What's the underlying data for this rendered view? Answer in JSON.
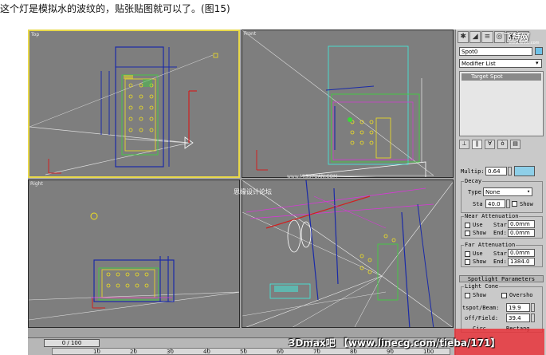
{
  "caption": "这个灯是模拟水的波纹的，贴张贴图就可以了。(图15)",
  "viewports": {
    "top": "Top",
    "front": "Front",
    "right": "Right"
  },
  "logo": {
    "text": "飞特网",
    "sub": "www.fevte.com"
  },
  "command_panel": {
    "object_name": "Spot0",
    "modifier_list": "Modifier List",
    "stack_item": "Target Spot",
    "multiplier_label": "Multip:",
    "multiplier_value": "0.64",
    "color_swatch": "#8ecfe8",
    "decay": {
      "title": "Decay",
      "type_label": "Type",
      "type_value": "None",
      "start_label": "Sta",
      "start_value": "40.0",
      "show_label": "Show"
    },
    "near": {
      "title": "Near Attenuation",
      "use": "Use",
      "show": "Show",
      "start_label": "Star",
      "start_value": "0.0mm",
      "end_label": "End:",
      "end_value": "0.0mm"
    },
    "far": {
      "title": "Far Attenuation",
      "use": "Use",
      "show": "Show",
      "start_label": "Star",
      "start_value": "0.0mm",
      "end_label": "End:",
      "end_value": "1384.0"
    },
    "spot_rollout": "Spotlight Parameters",
    "light_cone": {
      "title": "Light Cone",
      "show": "Show",
      "overshoot": "Oversho",
      "hotspot_label": "tspot/Beam:",
      "hotspot_value": "19.9",
      "falloff_label": "off/Field:",
      "falloff_value": "39.4",
      "circle": "Circ",
      "rect": "Rectang"
    }
  },
  "timeline": {
    "frame": "0 / 100",
    "ticks": [
      "10",
      "20",
      "30",
      "40",
      "50",
      "60",
      "70",
      "80",
      "90",
      "100"
    ]
  },
  "watermarks": {
    "bottom": "3Dmax吧 【www.linecg.com/tieba/171】",
    "middle": "思缘设计论坛",
    "middle2": "www.MISSYUAN.COM"
  },
  "colors": {
    "viewport_bg": "#7e7e7e",
    "active_border": "#e8d84a",
    "wire_blue": "#1a2aa8",
    "wire_cyan": "#3ff0e0",
    "wire_green": "#38d838",
    "wire_yellow": "#f0e020",
    "wire_white": "#eeeeee",
    "wire_magenta": "#d838d8",
    "axis_red": "#d02020"
  }
}
